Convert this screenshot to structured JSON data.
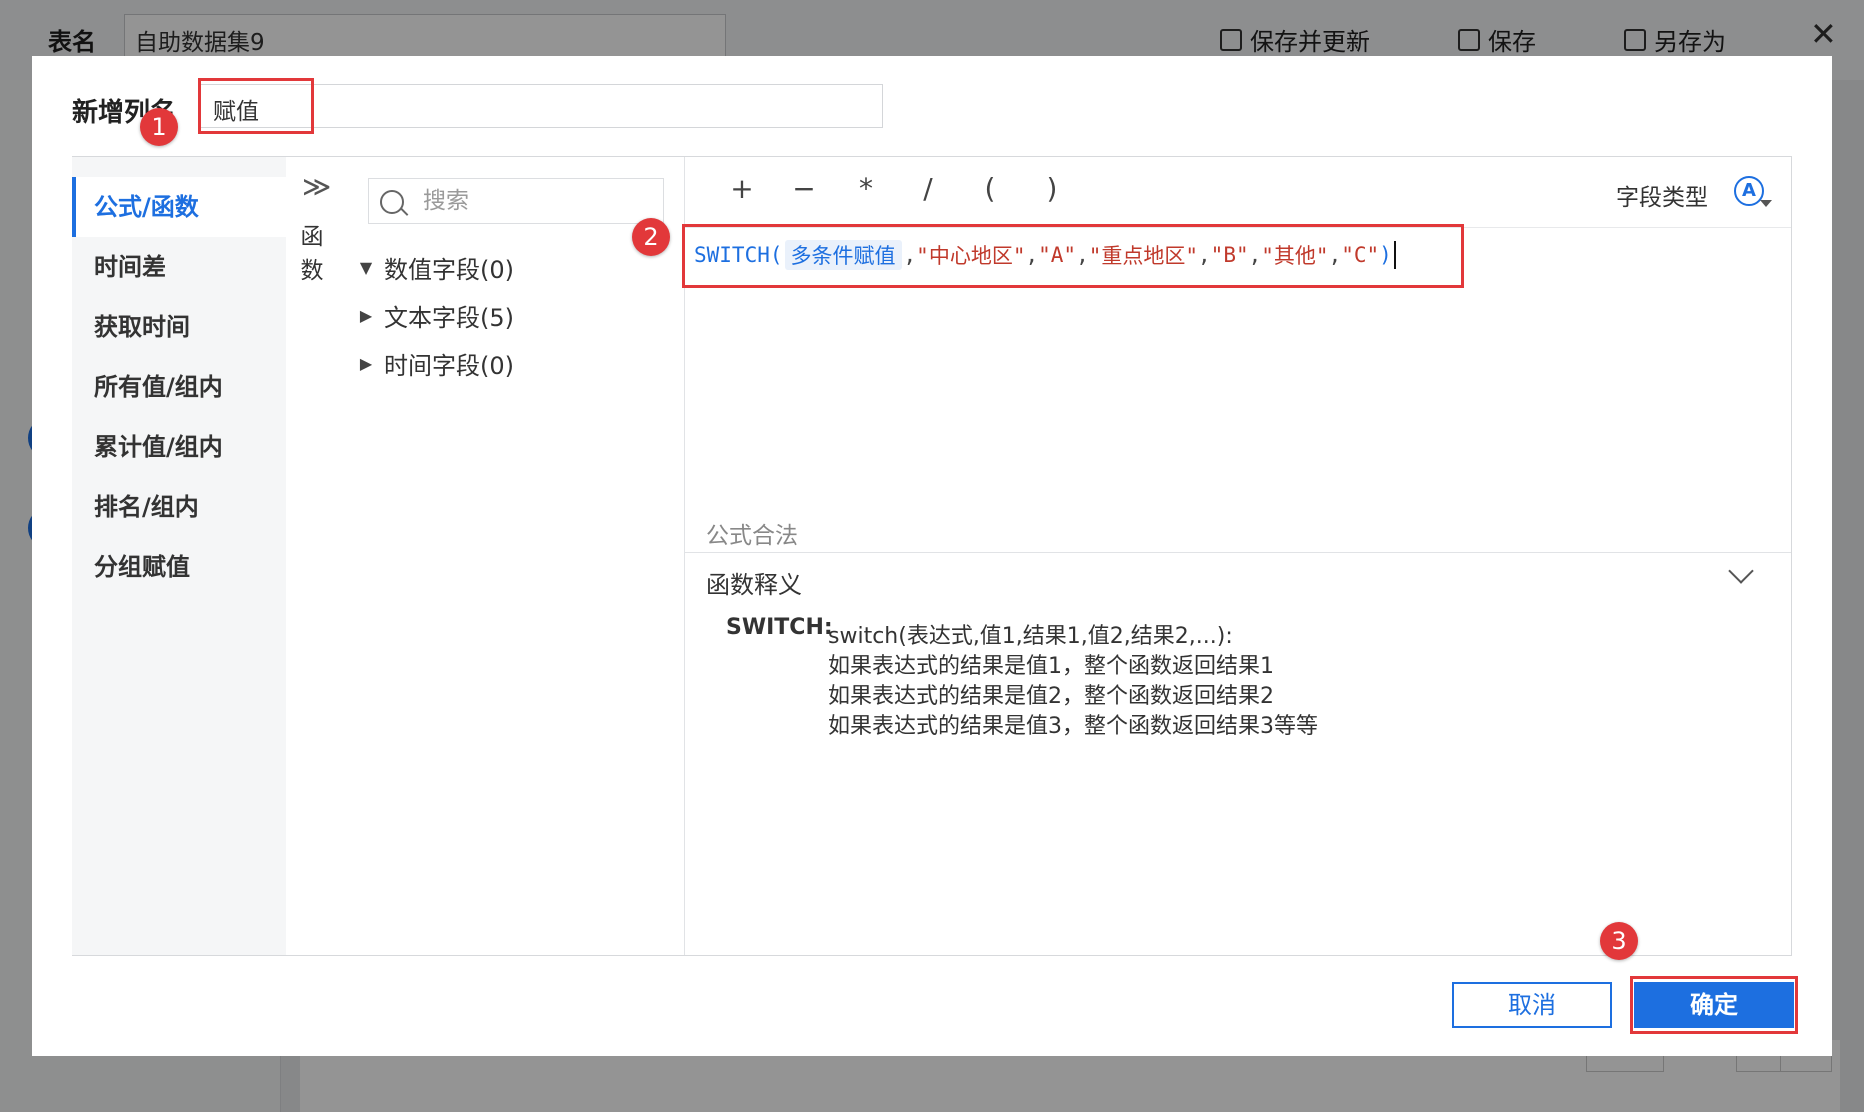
{
  "background": {
    "table_label": "表名",
    "table_name": "自助数据集9",
    "actions": [
      {
        "label": "保存并更新",
        "icon": "save-update-icon"
      },
      {
        "label": "保存",
        "icon": "save-icon"
      },
      {
        "label": "另存为",
        "icon": "save-as-icon"
      }
    ],
    "close_icon": "✕"
  },
  "dialog": {
    "new_column_label": "新增列名",
    "new_column_value": "赋值",
    "nav_items": [
      "公式/函数",
      "时间差",
      "获取时间",
      "所有值/组内",
      "累计值/组内",
      "排名/组内",
      "分组赋值"
    ],
    "active_nav": 0,
    "function_strip": {
      "chevron": "≫",
      "label": "函数"
    },
    "search_placeholder": "搜索",
    "field_groups": [
      {
        "label": "数值字段(0)",
        "expanded": true
      },
      {
        "label": "文本字段(5)",
        "expanded": false
      },
      {
        "label": "时间字段(0)",
        "expanded": false
      }
    ],
    "operators": [
      "+",
      "−",
      "*",
      "/",
      "(",
      ")"
    ],
    "field_type_label": "字段类型",
    "formula": {
      "fn": "SWITCH(",
      "field": "多条件赋值",
      "args_tail": [
        ",",
        "\"中心地区\"",
        ",",
        "\"A\"",
        ",",
        "\"重点地区\"",
        ",",
        "\"B\"",
        ",",
        "\"其他\"",
        ",",
        "\"C\"",
        ")"
      ]
    },
    "validity": "公式合法",
    "definition_title": "函数释义",
    "definition_fn": "SWITCH:",
    "definition_lines": [
      "switch(表达式,值1,结果1,值2,结果2,...):",
      "如果表达式的结果是值1，整个函数返回结果1",
      "如果表达式的结果是值2，整个函数返回结果2",
      "如果表达式的结果是值3，整个函数返回结果3等等"
    ],
    "cancel_label": "取消",
    "ok_label": "确定"
  },
  "annotations": [
    "1",
    "2",
    "3"
  ],
  "colors": {
    "accent": "#1d6fe0",
    "callout": "#e2383a",
    "string": "#c0392b"
  }
}
